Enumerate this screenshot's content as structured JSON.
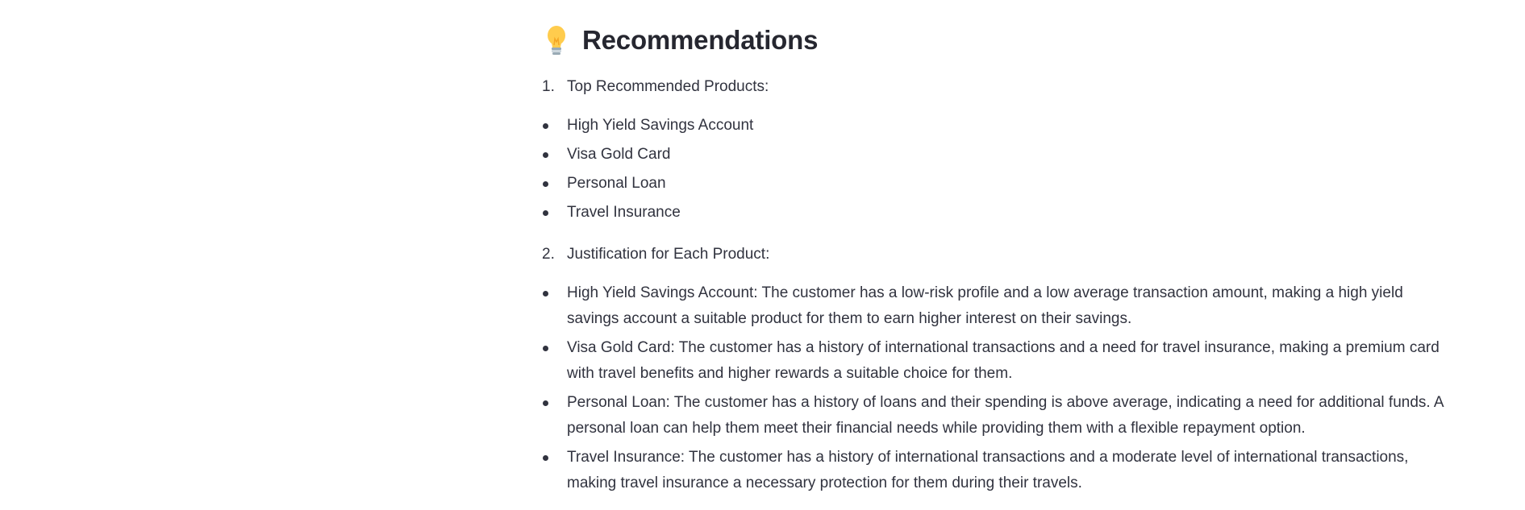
{
  "section": {
    "icon": "lightbulb-icon",
    "title": "Recommendations"
  },
  "steps": [
    {
      "marker": "1.",
      "label": "Top Recommended Products:",
      "items": [
        "High Yield Savings Account",
        "Visa Gold Card",
        "Personal Loan",
        "Travel Insurance"
      ]
    },
    {
      "marker": "2.",
      "label": "Justification for Each Product:",
      "items": [
        "High Yield Savings Account: The customer has a low-risk profile and a low average transaction amount, making a high yield savings account a suitable product for them to earn higher interest on their savings.",
        "Visa Gold Card: The customer has a history of international transactions and a need for travel insurance, making a premium card with travel benefits and higher rewards a suitable choice for them.",
        "Personal Loan: The customer has a history of loans and their spending is above average, indicating a need for additional funds. A personal loan can help them meet their financial needs while providing them with a flexible repayment option.",
        "Travel Insurance: The customer has a history of international transactions and a moderate level of international transactions, making travel insurance a necessary protection for them during their travels."
      ]
    }
  ]
}
